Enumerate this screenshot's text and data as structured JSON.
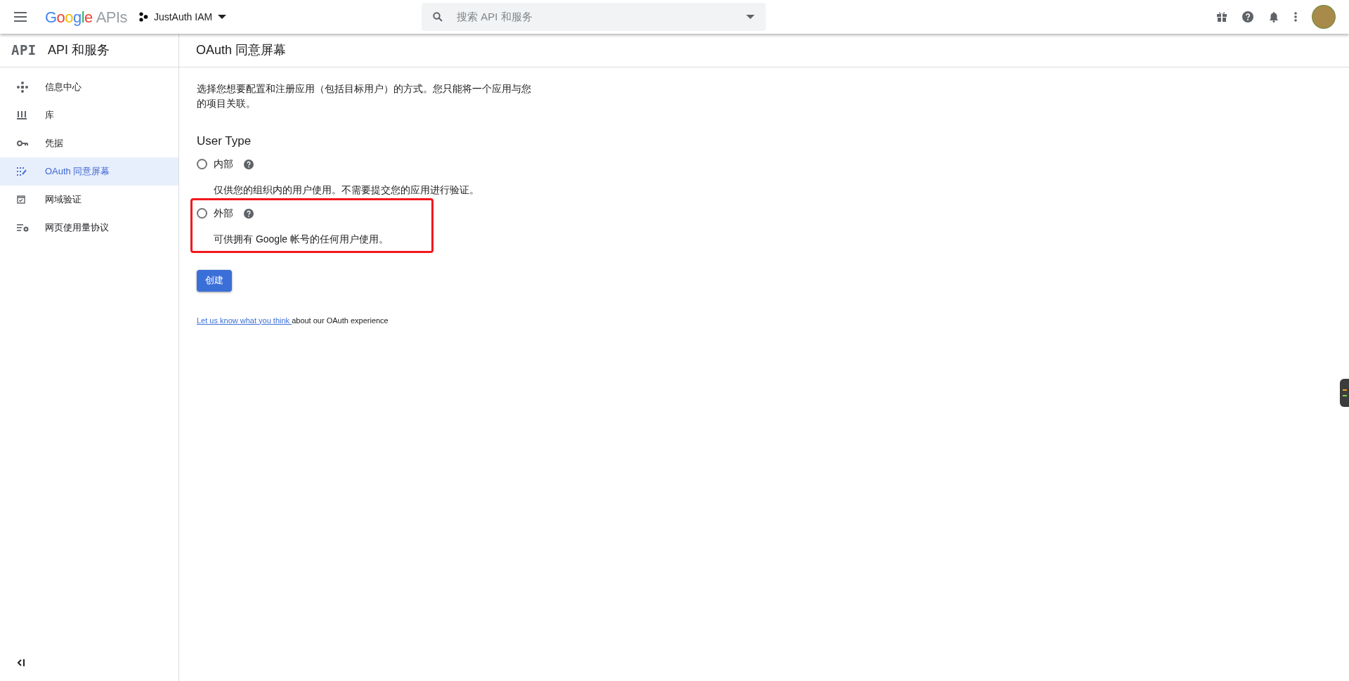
{
  "header": {
    "logo_brand": "Google",
    "logo_product": "APIs",
    "project": "JustAuth IAM",
    "search": {
      "placeholder": "搜索 API 和服务"
    }
  },
  "sidebar": {
    "logo": "API",
    "title": "API 和服务",
    "items": [
      {
        "label": "信息中心",
        "kind": "dashboard",
        "selected": false
      },
      {
        "label": "库",
        "kind": "library",
        "selected": false
      },
      {
        "label": "凭据",
        "kind": "key",
        "selected": false
      },
      {
        "label": "OAuth 同意屏幕",
        "kind": "consent",
        "selected": true
      },
      {
        "label": "网域验证",
        "kind": "checkbox",
        "selected": false
      },
      {
        "label": "网页使用量协议",
        "kind": "settings",
        "selected": false
      }
    ]
  },
  "page": {
    "title": "OAuth 同意屏幕",
    "intro": "选择您想要配置和注册应用（包括目标用户）的方式。您只能将一个应用与您的项目关联。",
    "section_title": "User Type",
    "options": [
      {
        "label": "内部",
        "description": "仅供您的组织内的用户使用。不需要提交您的应用进行验证。",
        "selected": false,
        "highlighted": false
      },
      {
        "label": "外部",
        "description": "可供拥有 Google 帐号的任何用户使用。",
        "selected": false,
        "highlighted": true
      }
    ],
    "create_button": "创建",
    "feedback_link": "Let us know what you think ",
    "feedback_text": "about our OAuth experience"
  }
}
